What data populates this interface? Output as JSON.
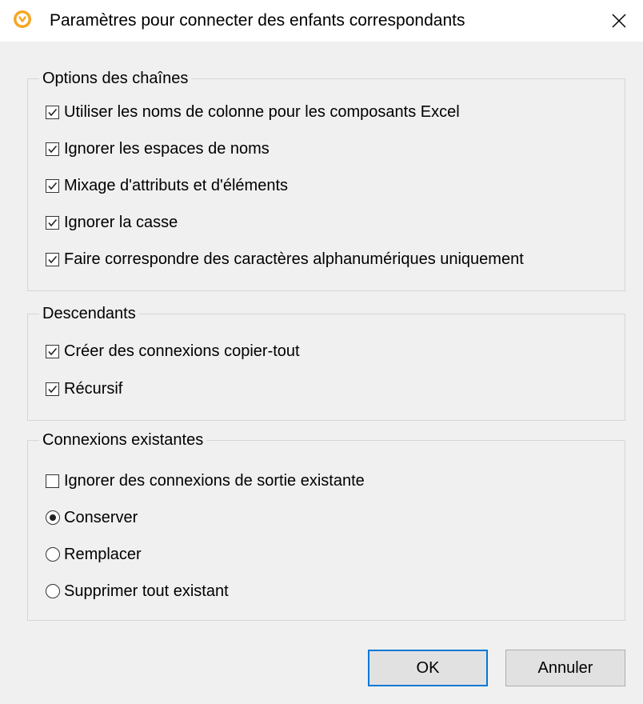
{
  "window": {
    "title": "Paramètres pour connecter des enfants correspondants",
    "icon": "altova-app-icon",
    "close_icon": "close-icon",
    "accent_color": "#f5a623"
  },
  "groups": {
    "string_options": {
      "legend": "Options des chaînes",
      "items": [
        {
          "label": "Utiliser les noms de colonne pour les composants Excel",
          "checked": true
        },
        {
          "label": "Ignorer les espaces de noms",
          "checked": true
        },
        {
          "label": "Mixage d'attributs et d'éléments",
          "checked": true
        },
        {
          "label": "Ignorer la casse",
          "checked": true
        },
        {
          "label": "Faire correspondre des caractères alphanumériques uniquement",
          "checked": true
        }
      ]
    },
    "descendants": {
      "legend": "Descendants",
      "items": [
        {
          "label": "Créer des connexions copier-tout",
          "checked": true
        },
        {
          "label": "Récursif",
          "checked": true
        }
      ]
    },
    "existing_connections": {
      "legend": "Connexions existantes",
      "checkbox": {
        "label": "Ignorer des connexions de sortie existante",
        "checked": false
      },
      "radios": [
        {
          "label": "Conserver",
          "selected": true
        },
        {
          "label": "Remplacer",
          "selected": false
        },
        {
          "label": "Supprimer tout existant",
          "selected": false
        }
      ]
    }
  },
  "buttons": {
    "ok_label": "OK",
    "cancel_label": "Annuler"
  }
}
